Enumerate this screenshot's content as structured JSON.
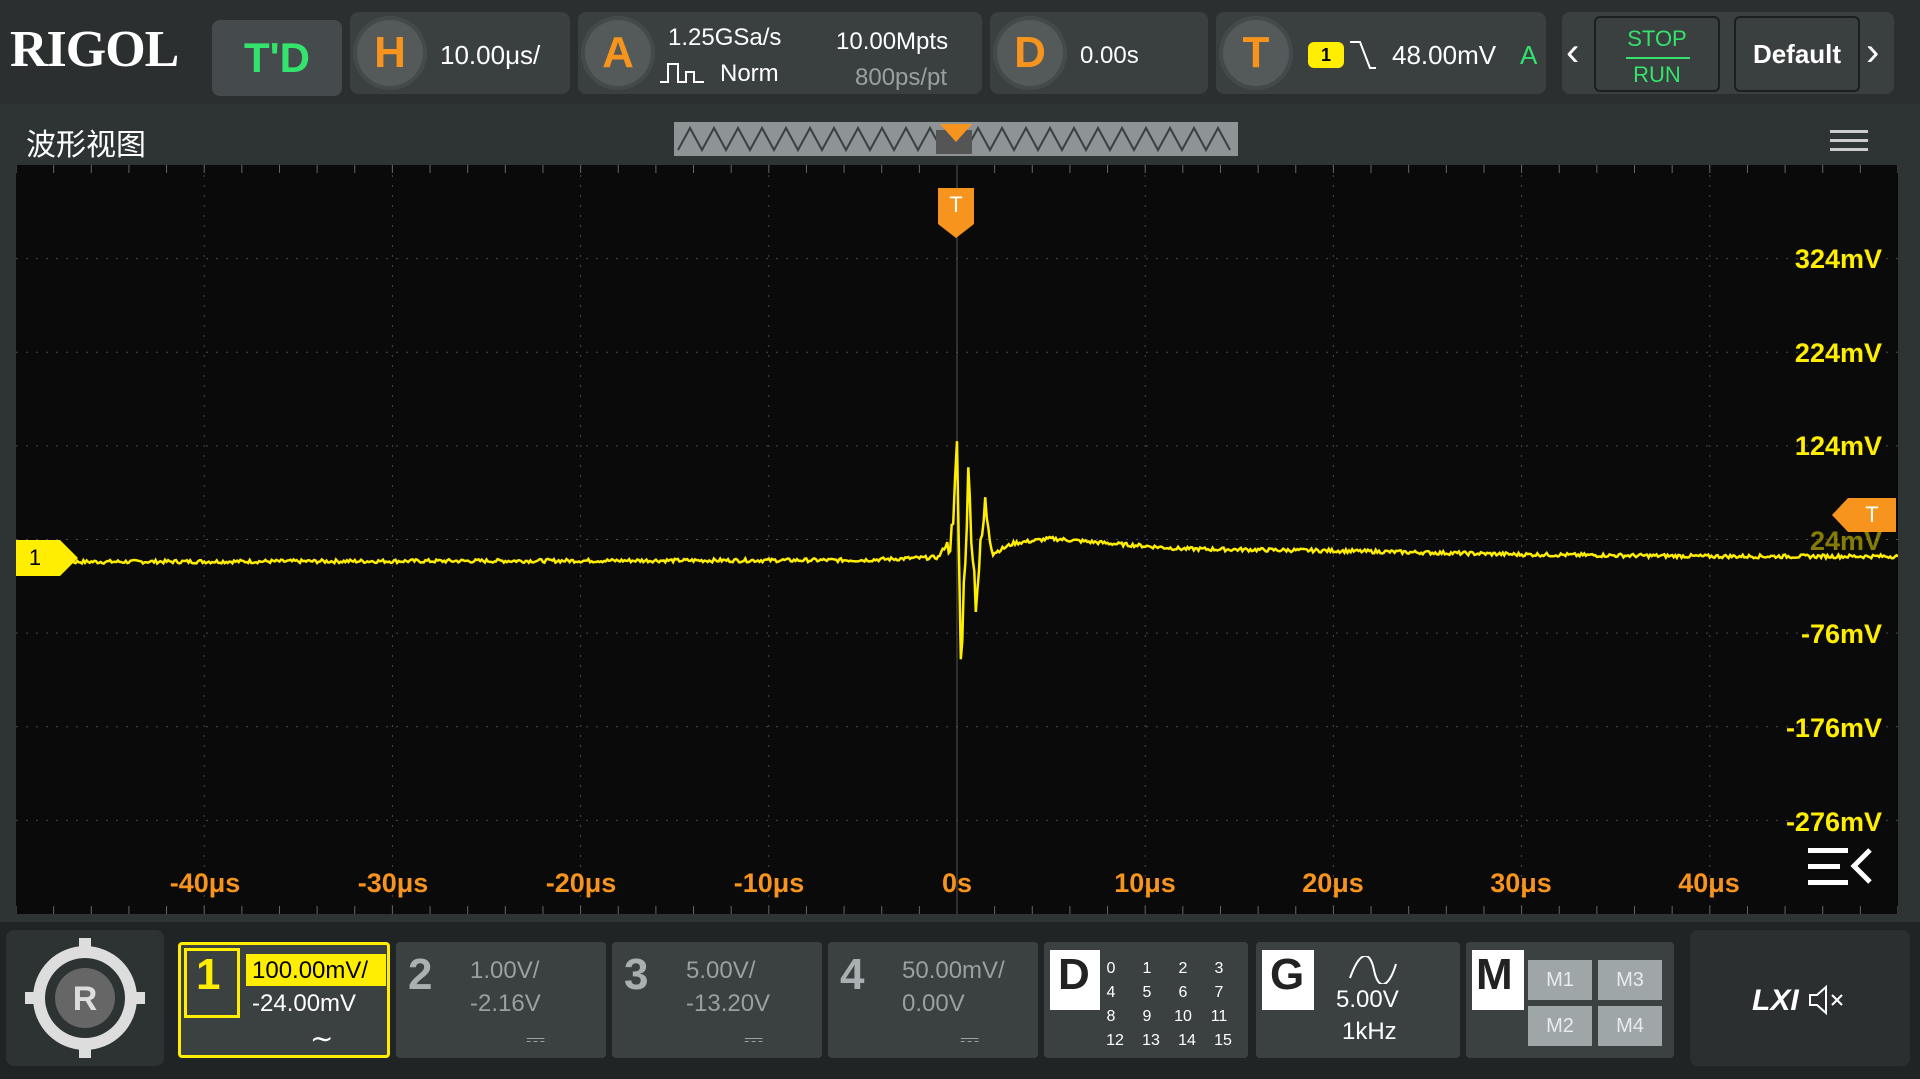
{
  "brand": {
    "logo": "RIGOL",
    "mode": "T'D"
  },
  "horizontal": {
    "key": "H",
    "scale": "10.00μs/"
  },
  "acquire": {
    "key": "A",
    "rate": "1.25GSa/s",
    "mode": "Norm",
    "depth": "10.00Mpts",
    "res": "800ps/pt"
  },
  "delay": {
    "key": "D",
    "value": "0.00s"
  },
  "trigger": {
    "key": "T",
    "source": "1",
    "level": "48.00mV",
    "sweep": "A",
    "marker": "T"
  },
  "run": {
    "stop": "STOP",
    "run": "RUN"
  },
  "default_label": "Default",
  "window": {
    "title": "波形视图"
  },
  "y_labels": [
    "324mV",
    "224mV",
    "124mV",
    "24mV",
    "-76mV",
    "-176mV",
    "-276mV"
  ],
  "x_labels": [
    "-40μs",
    "-30μs",
    "-20μs",
    "-10μs",
    "0s",
    "10μs",
    "20μs",
    "30μs",
    "40μs"
  ],
  "channels": [
    {
      "num": "1",
      "scale": "100.00mV/",
      "offset": "-24.00mV",
      "coupling": "∼",
      "color": "#ffee00",
      "active": true
    },
    {
      "num": "2",
      "scale": "1.00V/",
      "offset": "-2.16V",
      "coupling": "⎓",
      "active": false
    },
    {
      "num": "3",
      "scale": "5.00V/",
      "offset": "-13.20V",
      "coupling": "⎓",
      "active": false
    },
    {
      "num": "4",
      "scale": "50.00mV/",
      "offset": "0.00V",
      "coupling": "⎓",
      "active": false
    }
  ],
  "digital": {
    "key": "D",
    "rows": [
      [
        "0",
        "1",
        "2",
        "3"
      ],
      [
        "4",
        "5",
        "6",
        "7"
      ],
      [
        "8",
        "9",
        "10",
        "11"
      ],
      [
        "12",
        "13",
        "14",
        "15"
      ]
    ]
  },
  "generator": {
    "key": "G",
    "amp": "5.00V",
    "freq": "1kHz"
  },
  "math": {
    "key": "M",
    "cells": [
      "M1",
      "M3",
      "M2",
      "M4"
    ]
  },
  "lxi": "LXI",
  "ch1_marker": "1",
  "colors": {
    "trace": "#ffee00",
    "accent": "#f7941d",
    "active_green": "#34e36c"
  },
  "chart_data": {
    "type": "line",
    "title": "",
    "xlabel": "",
    "ylabel": "",
    "xlim": [
      -50,
      50
    ],
    "ylim": [
      -376,
      424
    ],
    "series": [
      {
        "x": [
          -50,
          -5,
          -1,
          -0.2,
          0,
          0.2,
          0.6,
          1,
          1.5,
          2,
          3,
          5,
          8,
          12,
          20,
          30,
          40,
          50
        ],
        "y": [
          0,
          2,
          5,
          30,
          130,
          -110,
          90,
          -40,
          60,
          10,
          20,
          25,
          20,
          14,
          12,
          8,
          6,
          6
        ]
      }
    ]
  }
}
